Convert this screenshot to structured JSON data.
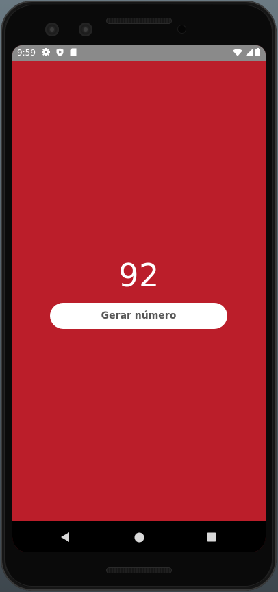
{
  "status_bar": {
    "time": "9:59",
    "left_icons": [
      "gear-icon",
      "play-protect-icon",
      "sd-card-icon"
    ],
    "right_icons": [
      "wifi-icon",
      "signal-icon",
      "battery-icon"
    ]
  },
  "app": {
    "background_color": "#bb1e2a",
    "number": "92",
    "generate_button_label": "Gerar número"
  },
  "navigation_bar": {
    "buttons": [
      "back-icon",
      "home-icon",
      "recents-icon"
    ]
  }
}
